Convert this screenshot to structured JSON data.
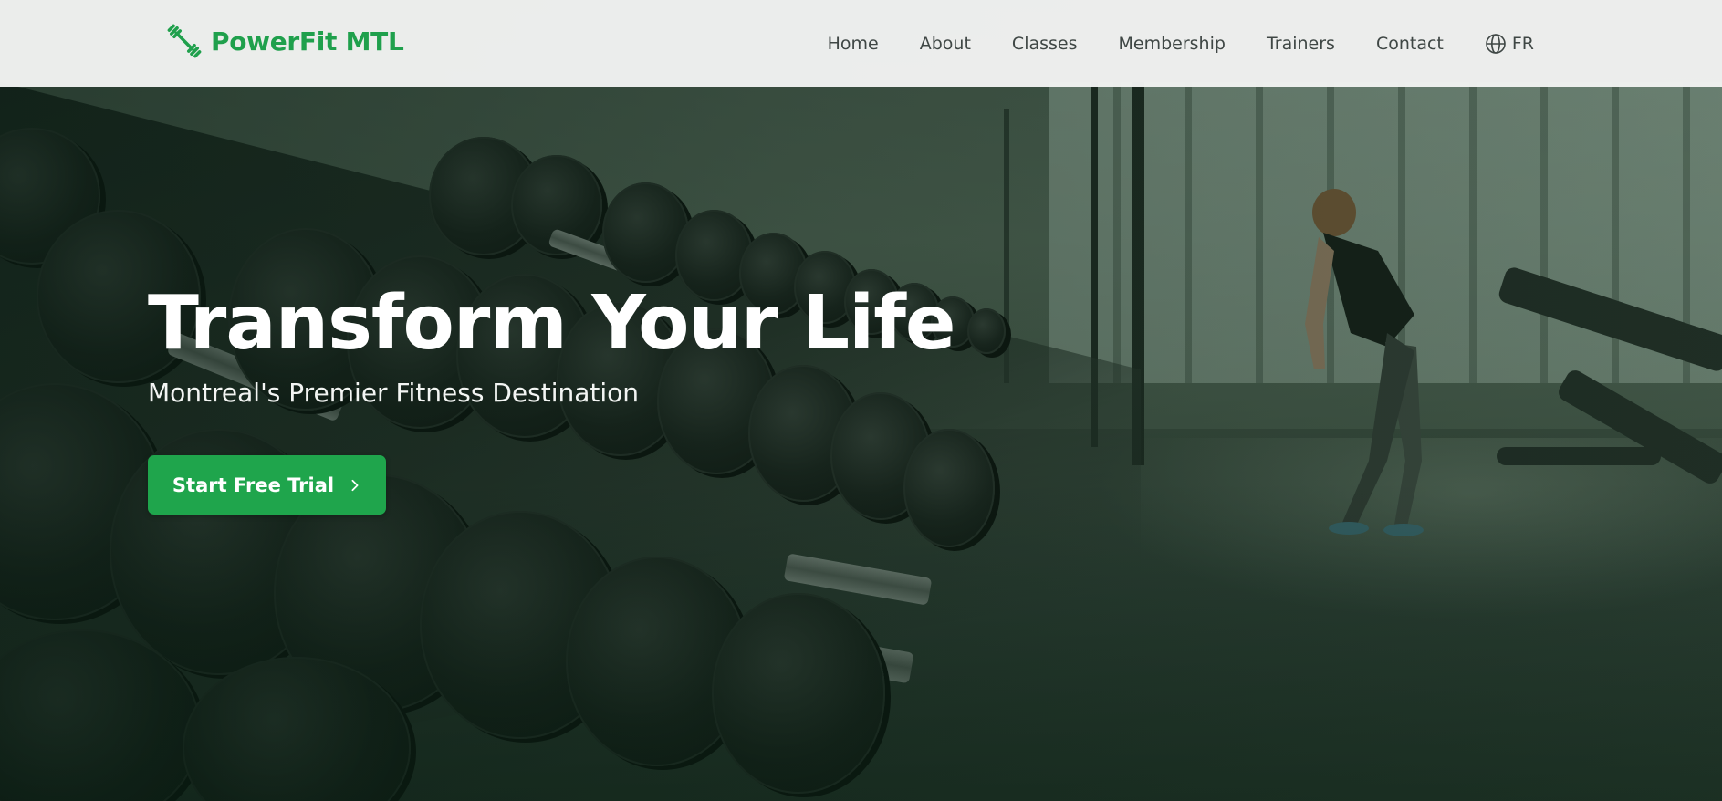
{
  "brand": {
    "name": "PowerFit MTL",
    "icon": "dumbbell-icon",
    "color": "#1fa04c"
  },
  "nav": {
    "items": [
      {
        "label": "Home"
      },
      {
        "label": "About"
      },
      {
        "label": "Classes"
      },
      {
        "label": "Membership"
      },
      {
        "label": "Trainers"
      },
      {
        "label": "Contact"
      }
    ],
    "language": {
      "label": "FR",
      "icon": "globe-icon"
    }
  },
  "hero": {
    "title": "Transform Your Life",
    "subtitle": "Montreal's Premier Fitness Destination",
    "cta_label": "Start Free Trial",
    "cta_icon": "chevron-right-icon",
    "cta_color": "#1fa54c",
    "background": "gym-dumbbell-rack-photo"
  }
}
